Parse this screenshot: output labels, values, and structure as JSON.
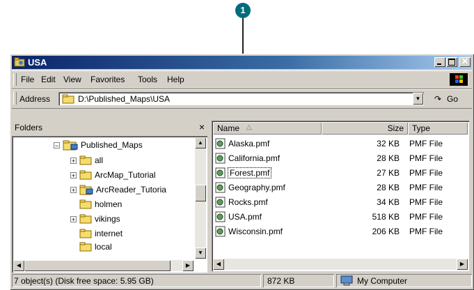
{
  "callout": {
    "number": "1"
  },
  "window": {
    "title": "USA",
    "menu": [
      "File",
      "Edit",
      "View",
      "Favorites",
      "Tools",
      "Help"
    ],
    "address": {
      "label": "Address",
      "value": "D:\\Published_Maps\\USA"
    },
    "go_label": "Go"
  },
  "folders": {
    "header": "Folders",
    "close": "×",
    "tree": [
      {
        "label": "Published_Maps",
        "expander": "−"
      },
      {
        "label": "all",
        "expander": "+"
      },
      {
        "label": "ArcMap_Tutorial",
        "expander": "+"
      },
      {
        "label": "ArcReader_Tutoria",
        "expander": "+"
      },
      {
        "label": "holmen",
        "expander": ""
      },
      {
        "label": "vikings",
        "expander": "+"
      },
      {
        "label": "internet",
        "expander": ""
      },
      {
        "label": "local",
        "expander": ""
      }
    ]
  },
  "files": {
    "columns": {
      "name": "Name",
      "size": "Size",
      "type": "Type"
    },
    "rows": [
      {
        "name": "Alaska.pmf",
        "size": "32 KB",
        "type": "PMF File"
      },
      {
        "name": "California.pmf",
        "size": "28 KB",
        "type": "PMF File"
      },
      {
        "name": "Forest.pmf",
        "size": "27 KB",
        "type": "PMF File"
      },
      {
        "name": "Geography.pmf",
        "size": "28 KB",
        "type": "PMF File"
      },
      {
        "name": "Rocks.pmf",
        "size": "34 KB",
        "type": "PMF File"
      },
      {
        "name": "USA.pmf",
        "size": "518 KB",
        "type": "PMF File"
      },
      {
        "name": "Wisconsin.pmf",
        "size": "206 KB",
        "type": "PMF File"
      }
    ]
  },
  "status": {
    "objects": "7 object(s) (Disk free space: 5.95 GB)",
    "size": "872 KB",
    "location": "My Computer"
  },
  "colors": {
    "titlebar": "#0a246a",
    "callout": "#006b7a",
    "chrome": "#d4d0c8"
  }
}
